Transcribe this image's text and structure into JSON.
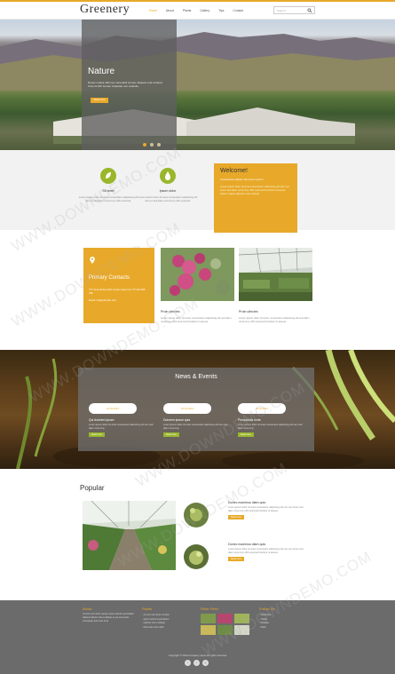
{
  "header": {
    "logo": "Greenery",
    "nav": [
      "Home",
      "About",
      "Plants",
      "Gallery",
      "Tips",
      "Contact"
    ],
    "search_placeholder": "Search"
  },
  "hero": {
    "title": "Nature",
    "text": "Donec massa nibh nec venenatis cursus. Aliquam erat volutpat. Cras id nibh tempor vulputate nec molestie.",
    "button": "Read more",
    "dots": 3,
    "active_dot": 1
  },
  "features": [
    {
      "icon": "leaf-icon",
      "title": "Sit amet",
      "desc": "Lorem ipsum dolor sit amet consectetur adipiscing elit nam et sed diam nonummy nibh euismod."
    },
    {
      "icon": "drop-icon",
      "title": "Ipsum dolor",
      "desc": "Lorem ipsum dolor sit amet consectetur adipiscing elit nam et sed diam nonummy nibh euismod."
    }
  ],
  "welcome": {
    "title": "Welcome!",
    "subtitle": "consectetur adipisc elit Lorem ipsum",
    "desc": "Lorem ipsum dolor sit amet consectetur adipiscing elit nam nec lorem sed diam nonummy nibh euismod tincidunt ut laoreet dolore magna aliquam erat volutpat."
  },
  "contact": {
    "title": "Primary Contacts",
    "address": "777 Second Ave NW, Anyton street 12, TP 123 456 789",
    "email": "Email: info@domain.com"
  },
  "cards": [
    {
      "title": "Proin ultricies",
      "desc": "Lorem ipsum dolor sit amet, consectetur adipiscing elit sed diam nonummy nibh euismod tincidunt ut laoreet."
    },
    {
      "title": "Proin ultricies",
      "desc": "Lorem ipsum dolor sit amet, consectetur adipiscing elit sed diam nonummy nibh euismod tincidunt ut laoreet."
    }
  ],
  "news": {
    "title": "News & Events",
    "items": [
      {
        "date": "12.04.2014",
        "title": "Qui dolorem ipsum",
        "desc": "Lorem ipsum dolor sit amet consectetur adipiscing elit nam sed diam nonummy.",
        "button": "Read more"
      },
      {
        "date": "15.04.2014",
        "title": "Dolorem ipsum quia",
        "desc": "Lorem ipsum dolor sit amet consectetur adipiscing elit nam sed diam nonummy.",
        "button": "Read more"
      },
      {
        "date": "18.04.2014",
        "title": "Perspiciatis unde",
        "desc": "Lorem ipsum dolor sit amet consectetur adipiscing elit nam sed diam nonummy.",
        "button": "Read more"
      }
    ]
  },
  "popular": {
    "title": "Popular",
    "items": [
      {
        "title": "Donec maximus diam quis",
        "desc": "Lorem ipsum dolor sit amet consectetur adipiscing elit nam nec lorem sed diam nonummy nibh euismod tincidunt ut laoreet.",
        "button": "Read more"
      },
      {
        "title": "Donec maximus diam quis",
        "desc": "Lorem ipsum dolor sit amet consectetur adipiscing elit nam nec lorem sed diam nonummy nibh euismod tincidunt ut laoreet.",
        "button": "Read more"
      }
    ]
  },
  "footer": {
    "about_title": "About",
    "about_text": "Ut enim ad minim veniam quis nostrud exercitation ullamco laboris nisi ut aliquip ex ea commodo consequat duis aute irure.",
    "plants_title": "Plants",
    "plants_links": [
      "Ut enim ad minim veniam",
      "Quis nostrud exercitation",
      "Laboris nisi ut aliquip",
      "Duis aute irure dolor"
    ],
    "flickr_title": "Flickr Feed",
    "follow_title": "Follow Us",
    "follow_links": [
      "Facebook",
      "Twitter",
      "Google+",
      "Flickr"
    ],
    "copyright": "Copyright © 2014 Company name All rights reserved",
    "social": [
      "f",
      "t",
      "g"
    ]
  },
  "watermark": "WWW.DOWNDEMO.COM",
  "colors": {
    "accent": "#e8a92a",
    "green": "#9ab72c",
    "footer": "#6b6b6b"
  }
}
